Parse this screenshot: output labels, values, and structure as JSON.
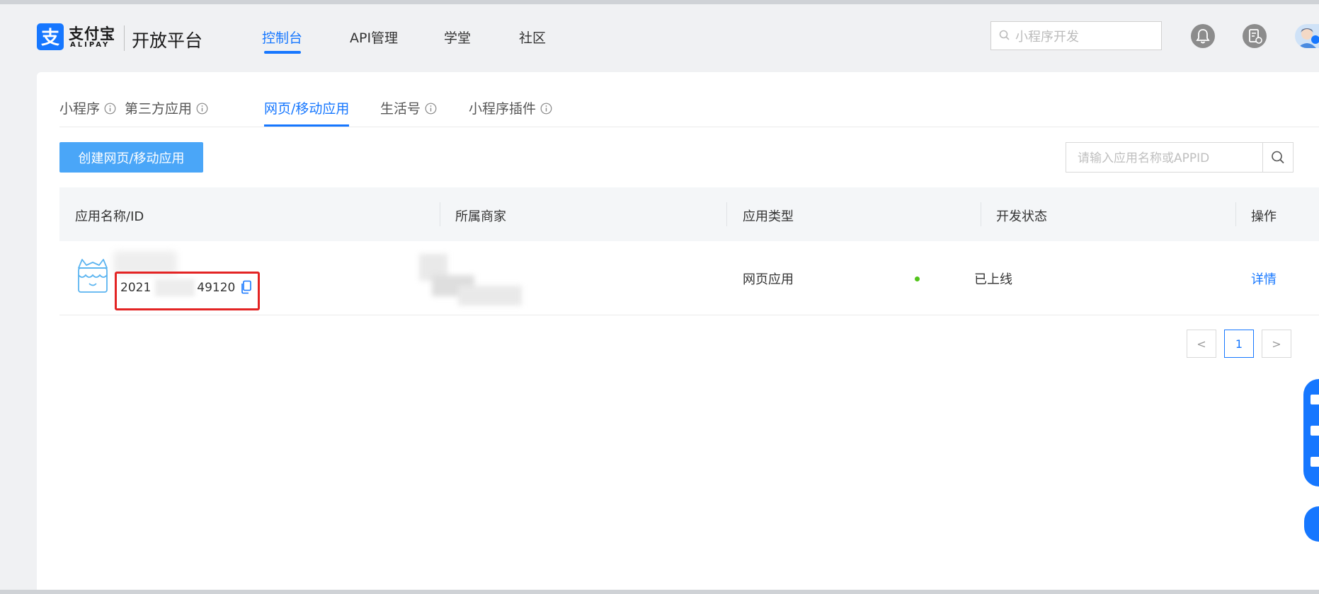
{
  "brand": {
    "logo_cn": "支付宝",
    "logo_en": "ALIPAY",
    "platform": "开放平台",
    "color": "#1677ff"
  },
  "nav": {
    "items": [
      {
        "label": "控制台",
        "active": true
      },
      {
        "label": "API管理",
        "active": false
      },
      {
        "label": "学堂",
        "active": false
      },
      {
        "label": "社区",
        "active": false
      }
    ]
  },
  "top_search": {
    "placeholder": "小程序开发",
    "icon": "search-icon"
  },
  "header_icons": [
    "bell-icon",
    "document-icon",
    "avatar"
  ],
  "tabs": [
    {
      "label": "小程序",
      "info": true,
      "active": false
    },
    {
      "label": "第三方应用",
      "info": true,
      "active": false
    },
    {
      "label": "网页/移动应用",
      "info": false,
      "active": true
    },
    {
      "label": "生活号",
      "info": true,
      "active": false
    },
    {
      "label": "小程序插件",
      "info": true,
      "active": false
    }
  ],
  "toolbar": {
    "create_label": "创建网页/移动应用",
    "search_placeholder": "请输入应用名称或APPID"
  },
  "table": {
    "columns": [
      "应用名称/ID",
      "所属商家",
      "应用类型",
      "开发状态",
      "操作"
    ],
    "rows": [
      {
        "app_id_prefix": "2021",
        "app_id_suffix": "49120",
        "app_type": "网页应用",
        "status": "已上线",
        "status_color": "#52c41a",
        "action": "详情"
      }
    ]
  },
  "pagination": {
    "prev": "<",
    "current": "1",
    "next": ">"
  }
}
